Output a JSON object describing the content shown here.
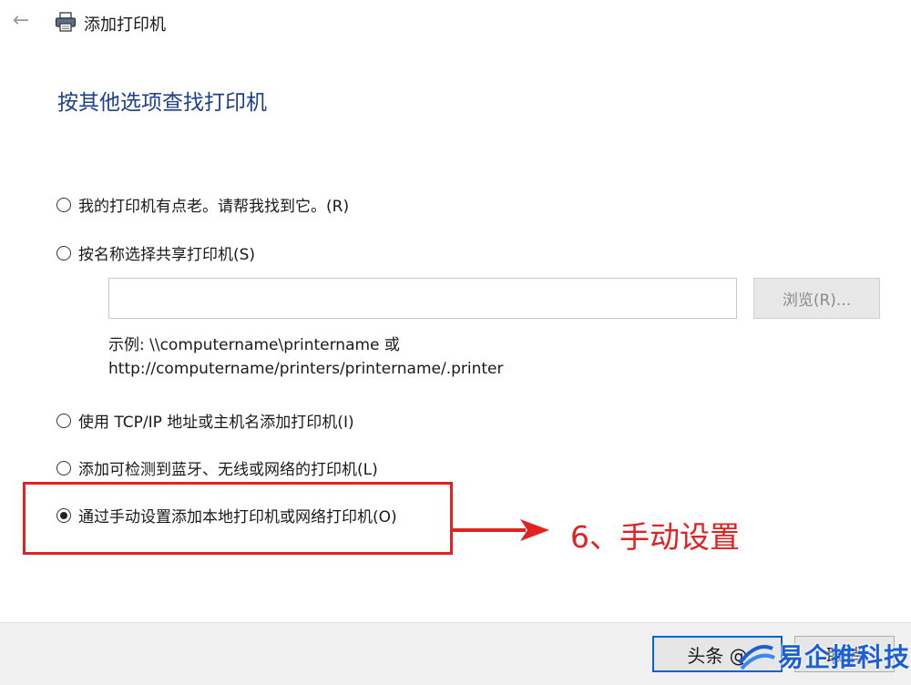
{
  "window": {
    "title": "添加打印机",
    "back_icon": "arrow-left-icon",
    "app_icon": "printer-icon"
  },
  "main": {
    "heading": "按其他选项查找打印机",
    "options": [
      {
        "label": "我的打印机有点老。请帮我找到它。(R)",
        "selected": false
      },
      {
        "label": "按名称选择共享打印机(S)",
        "selected": false
      },
      {
        "label": "使用 TCP/IP 地址或主机名添加打印机(I)",
        "selected": false
      },
      {
        "label": "添加可检测到蓝牙、无线或网络的打印机(L)",
        "selected": false
      },
      {
        "label": "通过手动设置添加本地打印机或网络打印机(O)",
        "selected": true
      }
    ],
    "share_input": {
      "value": "",
      "placeholder": ""
    },
    "browse_label": "浏览(R)...",
    "example_line1": "示例: \\\\computername\\printername 或",
    "example_line2": "http://computername/printers/printername/.printer"
  },
  "annotation": {
    "text": "6、手动设置",
    "color": "#e02222"
  },
  "footer": {
    "next_label": "头条 @",
    "cancel_label": "取消"
  },
  "watermark": {
    "text": "易企推科技"
  },
  "colors": {
    "heading": "#1e3f8c",
    "accent_border": "#0a64c8",
    "highlight": "#e02222"
  }
}
